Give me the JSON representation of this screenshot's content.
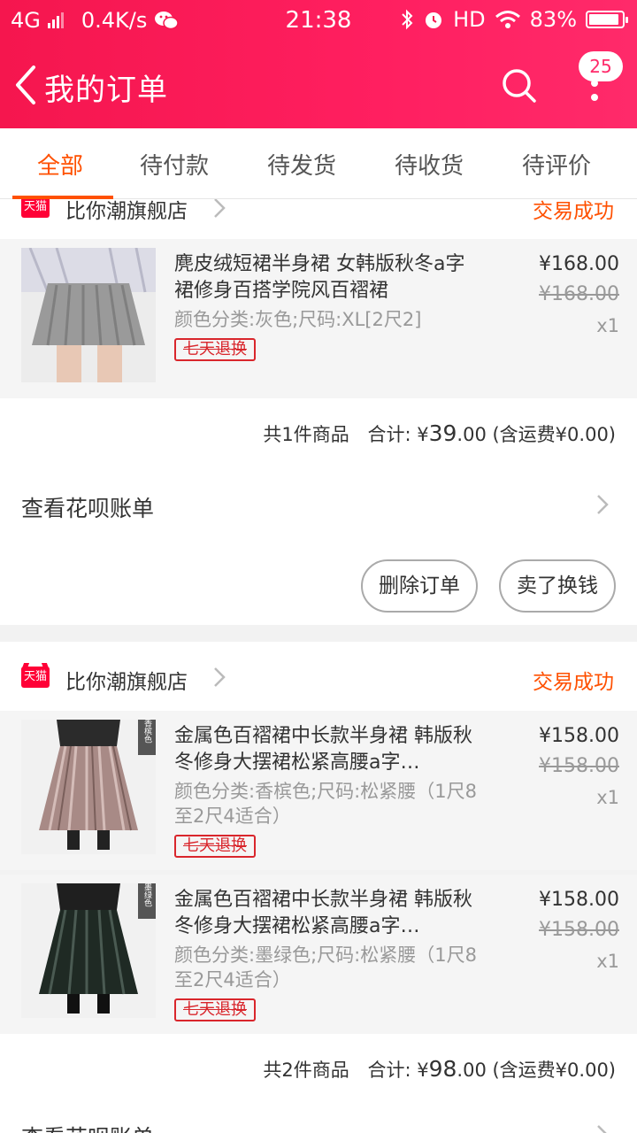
{
  "status_bar": {
    "network": "4G",
    "speed": "0.4K/s",
    "time": "21:38",
    "hd": "HD",
    "battery_percent": "83%"
  },
  "header": {
    "title": "我的订单",
    "badge_count": "25"
  },
  "tabs": [
    {
      "label": "全部",
      "active": true
    },
    {
      "label": "待付款",
      "active": false
    },
    {
      "label": "待发货",
      "active": false
    },
    {
      "label": "待收货",
      "active": false
    },
    {
      "label": "待评价",
      "active": false
    }
  ],
  "orders": [
    {
      "shop_badge": "天猫",
      "shop_name": "比你潮旗舰店",
      "status": "交易成功",
      "items": [
        {
          "title": "麂皮绒短裙半身裙 女韩版秋冬a字裙修身百搭学院风百褶裙",
          "spec": "颜色分类:灰色;尺码:XL[2尺2]",
          "tag": "七天退换",
          "price": "¥168.00",
          "original_price": "¥168.00",
          "quantity": "x1"
        }
      ],
      "summary": {
        "count_text": "共1件商品",
        "total_label": "合计: ",
        "currency": "¥",
        "total_amount": "39",
        "total_decimal": ".00",
        "shipping_text": " (含运费¥0.00)"
      },
      "bill_text": "查看花呗账单",
      "buttons": [
        "删除订单",
        "卖了换钱"
      ]
    },
    {
      "shop_badge": "天猫",
      "shop_name": "比你潮旗舰店",
      "status": "交易成功",
      "items": [
        {
          "title": "金属色百褶裙中长款半身裙 韩版秋冬修身大摆裙松紧高腰a字…",
          "spec": "颜色分类:香槟色;尺码:松紧腰（1尺8至2尺4适合）",
          "image_tag": "香槟色",
          "tag": "七天退换",
          "price": "¥158.00",
          "original_price": "¥158.00",
          "quantity": "x1"
        },
        {
          "title": "金属色百褶裙中长款半身裙 韩版秋冬修身大摆裙松紧高腰a字…",
          "spec": "颜色分类:墨绿色;尺码:松紧腰（1尺8至2尺4适合）",
          "image_tag": "墨绿色",
          "tag": "七天退换",
          "price": "¥158.00",
          "original_price": "¥158.00",
          "quantity": "x1"
        }
      ],
      "summary": {
        "count_text": "共2件商品",
        "total_label": "合计: ",
        "currency": "¥",
        "total_amount": "98",
        "total_decimal": ".00",
        "shipping_text": " (含运费¥0.00)"
      },
      "bill_text": "查看花呗账单"
    }
  ]
}
